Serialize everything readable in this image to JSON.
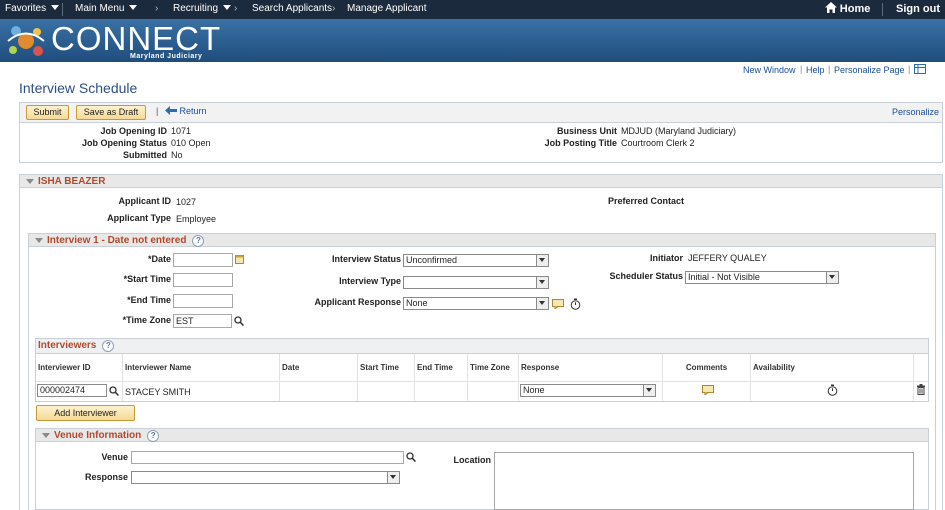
{
  "topnav": {
    "favorites": "Favorites",
    "main_menu": "Main Menu",
    "breadcrumb": [
      "Recruiting",
      "Search Applicants",
      "Manage Applicant"
    ],
    "home": "Home",
    "sign_out": "Sign out"
  },
  "banner": {
    "logo_text": "CONNECT",
    "logo_sub": "Maryland Judiciary"
  },
  "header_links": {
    "new_window": "New Window",
    "help": "Help",
    "personalize_page": "Personalize Page"
  },
  "page_title": "Interview Schedule",
  "toolbar": {
    "submit": "Submit",
    "save_draft": "Save as Draft",
    "return": "Return",
    "personalize": "Personalize"
  },
  "job": {
    "opening_id_label": "Job Opening ID",
    "opening_id": "1071",
    "status_label": "Job Opening Status",
    "status": "010 Open",
    "submitted_label": "Submitted",
    "submitted": "No",
    "business_unit_label": "Business Unit",
    "business_unit": "MDJUD (Maryland Judiciary)",
    "posting_title_label": "Job Posting Title",
    "posting_title": "Courtroom Clerk 2"
  },
  "applicant": {
    "name": "ISHA BEAZER",
    "id_label": "Applicant ID",
    "id": "1027",
    "type_label": "Applicant Type",
    "type": "Employee",
    "preferred_contact_label": "Preferred Contact"
  },
  "interview": {
    "title": "Interview 1 - Date not entered",
    "date_label": "*Date",
    "date": "",
    "start_label": "*Start Time",
    "start": "",
    "end_label": "*End Time",
    "end": "",
    "tz_label": "*Time Zone",
    "tz": "EST",
    "status_label": "Interview Status",
    "status": "Unconfirmed",
    "type_label": "Interview Type",
    "type": "",
    "response_label": "Applicant Response",
    "response": "None",
    "initiator_label": "Initiator",
    "initiator": "JEFFERY QUALEY",
    "scheduler_label": "Scheduler Status",
    "scheduler": "Initial - Not Visible"
  },
  "interviewers": {
    "title": "Interviewers",
    "columns": [
      "Interviewer ID",
      "Interviewer Name",
      "Date",
      "Start Time",
      "End Time",
      "Time Zone",
      "Response",
      "Comments",
      "Availability"
    ],
    "row": {
      "id": "000002474",
      "name": "STACEY SMITH",
      "response": "None"
    },
    "add_button": "Add Interviewer"
  },
  "venue": {
    "title": "Venue Information",
    "venue_label": "Venue",
    "venue": "",
    "response_label": "Response",
    "response": "",
    "location_label": "Location",
    "location": ""
  },
  "colors": {
    "nav_bg": "#1b2a3d",
    "banner": "#2a5f92",
    "section_title": "#b04a2e",
    "link": "#1a4ea1"
  }
}
